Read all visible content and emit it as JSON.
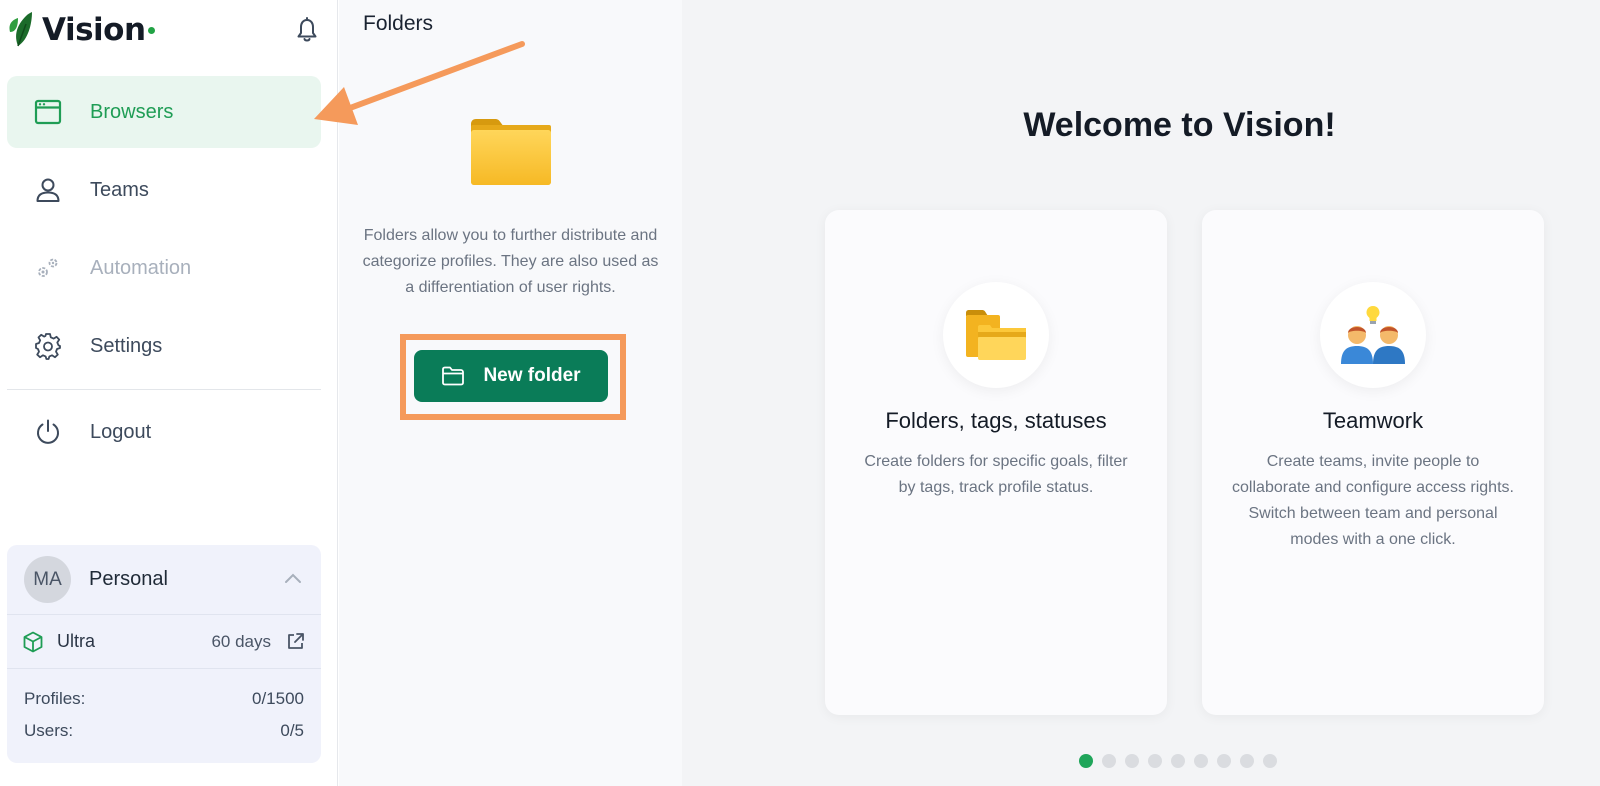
{
  "brand": {
    "name": "Vision",
    "accent": "#1f9d55"
  },
  "sidebar": {
    "items": [
      {
        "label": "Browsers",
        "icon": "browser-window-icon",
        "state": "active"
      },
      {
        "label": "Teams",
        "icon": "user-icon",
        "state": "normal"
      },
      {
        "label": "Automation",
        "icon": "gears-icon",
        "state": "disabled"
      },
      {
        "label": "Settings",
        "icon": "gear-icon",
        "state": "normal"
      },
      {
        "label": "Logout",
        "icon": "power-icon",
        "state": "normal"
      }
    ]
  },
  "account": {
    "initials": "MA",
    "name": "Personal",
    "plan": "Ultra",
    "days": "60 days",
    "profiles_label": "Profiles:",
    "profiles_value": "0/1500",
    "users_label": "Users:",
    "users_value": "0/5"
  },
  "folders": {
    "title": "Folders",
    "description": "Folders allow you to further distribute and categorize profiles. They are also used as a differentiation of user rights.",
    "new_folder_label": "New folder"
  },
  "main": {
    "welcome": "Welcome to Vision!",
    "cards": [
      {
        "title": "Folders, tags, statuses",
        "text": "Create folders for specific goals, filter by tags, track profile status.",
        "icon": "folder-icon"
      },
      {
        "title": "Teamwork",
        "text": "Create teams, invite people to collaborate and configure access rights. Switch between team and personal modes with a one click.",
        "icon": "team-idea-icon"
      }
    ],
    "carousel": {
      "total": 9,
      "active": 1
    }
  },
  "colors": {
    "primary_button": "#0a7c58",
    "highlight": "#f59a5b",
    "active_nav_bg": "#e9f6ef"
  }
}
